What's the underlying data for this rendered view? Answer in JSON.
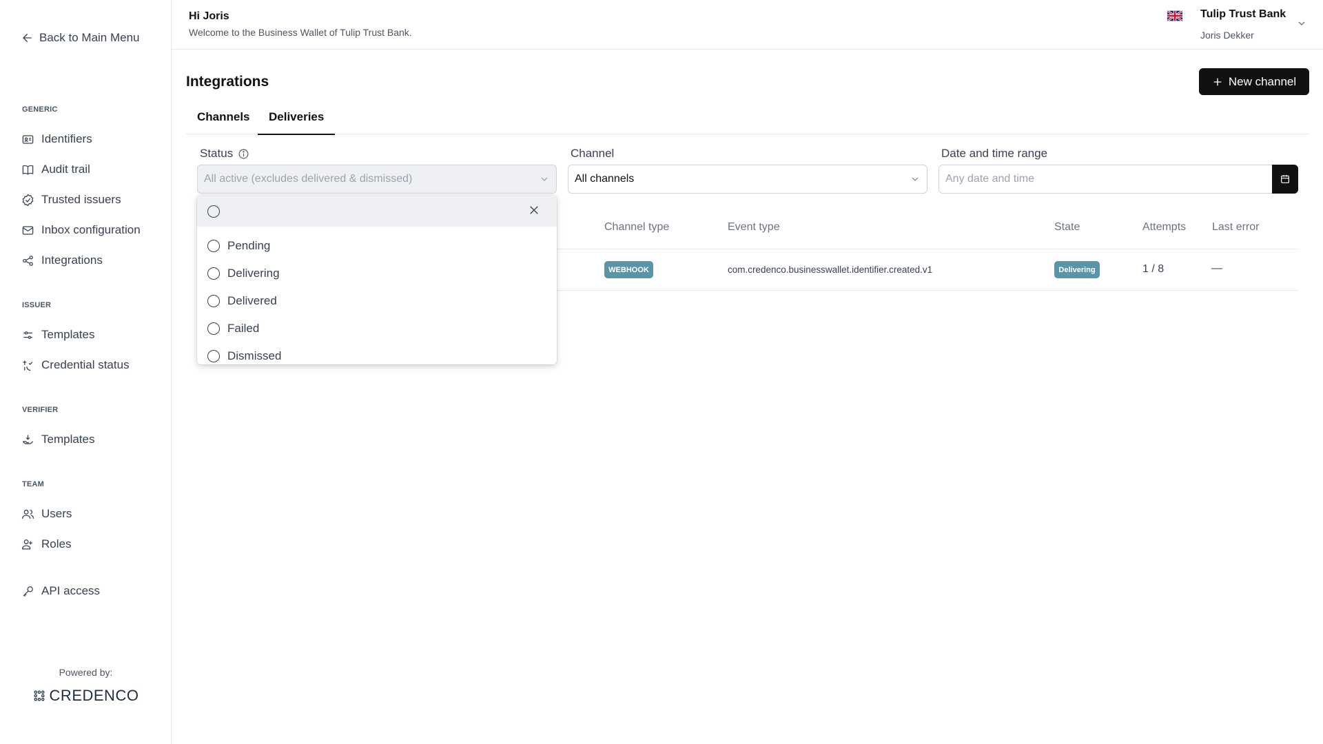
{
  "sidebar": {
    "back_label": "Back to Main Menu",
    "sections": {
      "generic": "GENERIC",
      "issuer": "ISSUER",
      "verifier": "VERIFIER",
      "team": "TEAM"
    },
    "items": [
      {
        "label": "Identifiers",
        "icon": "id-card-icon"
      },
      {
        "label": "Audit trail",
        "icon": "book-icon"
      },
      {
        "label": "Trusted issuers",
        "icon": "check-badge-icon"
      },
      {
        "label": "Inbox configuration",
        "icon": "mail-icon"
      },
      {
        "label": "Integrations",
        "icon": "share-icon"
      },
      {
        "label": "Templates",
        "icon": "sliders-icon"
      },
      {
        "label": "Credential status",
        "icon": "credential-status-icon"
      },
      {
        "label": "Templates",
        "icon": "hand-receive-icon"
      },
      {
        "label": "Users",
        "icon": "users-icon"
      },
      {
        "label": "Roles",
        "icon": "roles-icon"
      },
      {
        "label": "API access",
        "icon": "key-icon"
      }
    ],
    "powered_by": "Powered by:",
    "brand": "CREDENCO"
  },
  "header": {
    "greeting": "Hi Joris",
    "welcome": "Welcome to the Business Wallet of Tulip Trust Bank.",
    "org_name": "Tulip Trust Bank",
    "user_name": "Joris Dekker"
  },
  "main": {
    "title": "Integrations",
    "new_channel_label": "New channel",
    "tabs": [
      {
        "label": "Channels",
        "active": false
      },
      {
        "label": "Deliveries",
        "active": true
      }
    ],
    "filters": {
      "status_label": "Status",
      "status_value": "All active (excludes delivered & dismissed)",
      "channel_label": "Channel",
      "channel_value": "All channels",
      "date_label": "Date and time range",
      "date_placeholder": "Any date and time"
    },
    "table": {
      "columns": [
        "Channel type",
        "Event type",
        "State",
        "Attempts",
        "Last error"
      ],
      "rows": [
        {
          "channel_type": "WEBHOOK",
          "event_type": "com.credenco.businesswallet.identifier.created.v1",
          "state": "Delivering",
          "attempts": "1 / 8",
          "last_error": "—"
        }
      ]
    },
    "status_dropdown": {
      "options": [
        "Pending",
        "Delivering",
        "Delivered",
        "Failed",
        "Dismissed"
      ]
    }
  },
  "colors": {
    "primary": "#111111",
    "badge": "#5b93a8",
    "muted_bg": "#eef0f3"
  }
}
